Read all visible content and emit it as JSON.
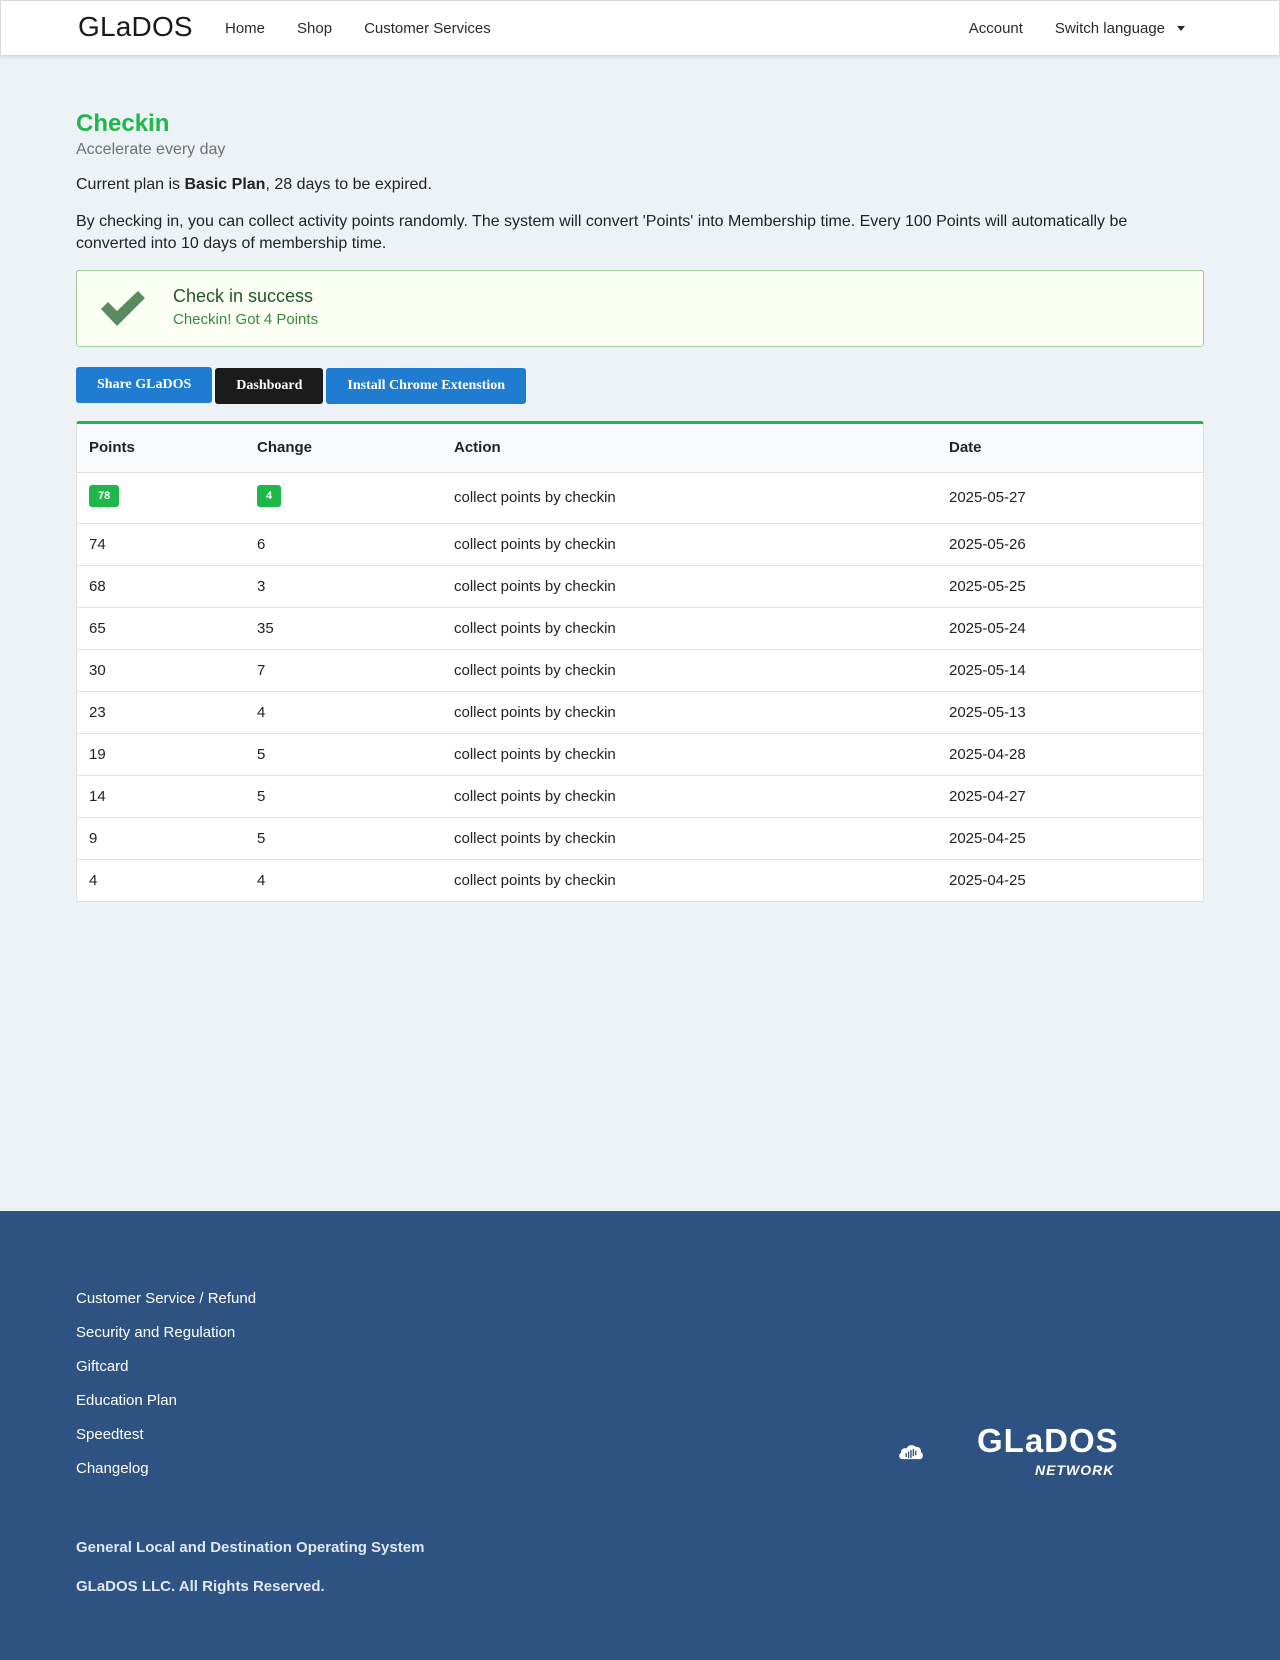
{
  "navbar": {
    "brand": "GLaDOS",
    "links": [
      "Home",
      "Shop",
      "Customer Services"
    ],
    "account": "Account",
    "language": "Switch language"
  },
  "page": {
    "title": "Checkin",
    "subtitle": "Accelerate every day",
    "plan_prefix": "Current plan is ",
    "plan_name": "Basic Plan",
    "plan_suffix": ", 28 days to be expired.",
    "description": "By checking in, you can collect activity points randomly. The system will convert 'Points' into Membership time. Every 100 Points will automatically be converted into 10 days of membership time."
  },
  "alert": {
    "heading": "Check in success",
    "message": "Checkin! Got 4 Points",
    "icon": "check-icon"
  },
  "buttons": {
    "share": "Share GLaDOS",
    "dashboard": "Dashboard",
    "extension": "Install Chrome Extenstion"
  },
  "table": {
    "headers": [
      "Points",
      "Change",
      "Action",
      "Date"
    ],
    "rows": [
      {
        "points": "78",
        "change": "4",
        "action": "collect points by checkin",
        "date": "2025-05-27"
      },
      {
        "points": "74",
        "change": "6",
        "action": "collect points by checkin",
        "date": "2025-05-26"
      },
      {
        "points": "68",
        "change": "3",
        "action": "collect points by checkin",
        "date": "2025-05-25"
      },
      {
        "points": "65",
        "change": "35",
        "action": "collect points by checkin",
        "date": "2025-05-24"
      },
      {
        "points": "30",
        "change": "7",
        "action": "collect points by checkin",
        "date": "2025-05-14"
      },
      {
        "points": "23",
        "change": "4",
        "action": "collect points by checkin",
        "date": "2025-05-13"
      },
      {
        "points": "19",
        "change": "5",
        "action": "collect points by checkin",
        "date": "2025-04-28"
      },
      {
        "points": "14",
        "change": "5",
        "action": "collect points by checkin",
        "date": "2025-04-27"
      },
      {
        "points": "9",
        "change": "5",
        "action": "collect points by checkin",
        "date": "2025-04-25"
      },
      {
        "points": "4",
        "change": "4",
        "action": "collect points by checkin",
        "date": "2025-04-25"
      }
    ]
  },
  "footer": {
    "links": [
      "Customer Service / Refund",
      "Security and Regulation",
      "Giftcard",
      "Education Plan",
      "Speedtest",
      "Changelog"
    ],
    "tagline": "General Local and Destination Operating System",
    "copyright": "GLaDOS LLC. All Rights Reserved.",
    "logo_text": "GLaDOS",
    "logo_sub": "NETWORK"
  },
  "colors": {
    "accent_green": "#1eb84a",
    "button_blue": "#1f7cd1",
    "footer_blue": "#2e5382",
    "background": "#edf2f6"
  }
}
